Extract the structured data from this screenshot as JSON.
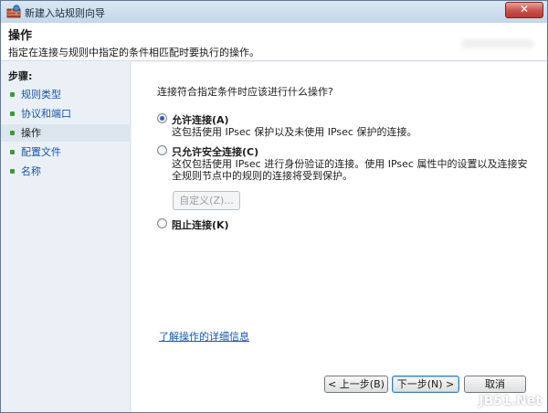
{
  "window": {
    "title": "新建入站规则向导",
    "close_label": "✕"
  },
  "header": {
    "title": "操作",
    "description": "指定在连接与规则中指定的条件相匹配时要执行的操作。"
  },
  "sidebar": {
    "title": "步骤:",
    "items": [
      {
        "label": "规则类型",
        "active": false
      },
      {
        "label": "协议和端口",
        "active": false
      },
      {
        "label": "操作",
        "active": true
      },
      {
        "label": "配置文件",
        "active": false
      },
      {
        "label": "名称",
        "active": false
      }
    ]
  },
  "main": {
    "question": "连接符合指定条件时应该进行什么操作?",
    "options": [
      {
        "label": "允许连接(A)",
        "desc": [
          "这包括使用 IPsec 保护以及未使用 IPsec 保护的连接。"
        ],
        "checked": true
      },
      {
        "label": "只允许安全连接(C)",
        "desc": [
          "这仅包括使用 IPsec 进行身份验证的连接。使用 IPsec 属性中的设置以及连接安",
          "全规则节点中的规则的连接将受到保护。"
        ],
        "checked": false
      },
      {
        "label": "阻止连接(K)",
        "desc": [],
        "checked": false
      }
    ],
    "custom_button": "自定义(Z)...",
    "learn_more": "了解操作的详细信息"
  },
  "footer": {
    "back": "< 上一步(B)",
    "next": "下一步(N) >",
    "cancel": "取消"
  },
  "watermark": "JB51.Net"
}
